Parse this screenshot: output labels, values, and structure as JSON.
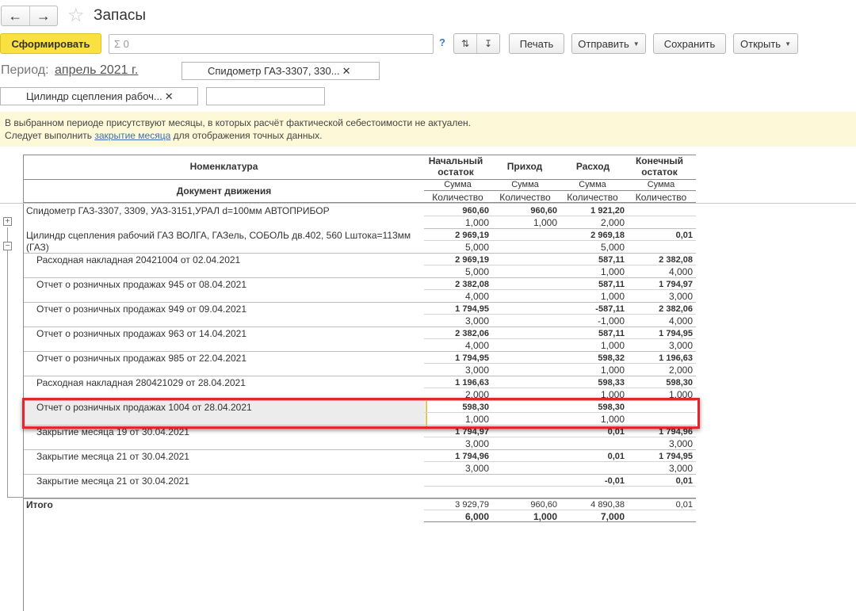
{
  "window": {
    "title": "Запасы"
  },
  "toolbar": {
    "generate_label": "Сформировать",
    "search_value": "Σ 0",
    "help_label": "?",
    "print_label": "Печать",
    "send_label": "Отправить",
    "save_label": "Сохранить",
    "open_label": "Открыть"
  },
  "filters": {
    "period_label": "Период:",
    "period_value": "апрель 2021 г.",
    "filter1": "Спидометр ГАЗ-3307, 330...",
    "filter2": "Цилиндр сцепления рабоч...",
    "filter3": ""
  },
  "warning": {
    "line1": "В выбранном периоде присутствуют месяцы, в которых расчёт фактической себестоимости не актуален.",
    "line2_before": "Следует выполнить ",
    "line2_link": "закрытие месяца",
    "line2_after": " для отображения точных данных."
  },
  "table": {
    "headers": {
      "nomenclature": "Номенклатура",
      "document": "Документ движения",
      "start": "Начальный остаток",
      "income": "Приход",
      "expense": "Расход",
      "end": "Конечный остаток",
      "sum": "Сумма",
      "qty": "Количество"
    },
    "rows": [
      {
        "name": "Спидометр ГАЗ-3307, 3309, УАЗ-3151,УРАЛ d=100мм АВТОПРИБОР",
        "level": 0,
        "sum": [
          "960,60",
          "960,60",
          "1 921,20",
          ""
        ],
        "qty": [
          "1,000",
          "1,000",
          "2,000",
          ""
        ]
      },
      {
        "name": "Цилиндр сцепления рабочий ГАЗ ВОЛГА, ГАЗель, СОБОЛЬ дв.402, 560 Lштока=113мм",
        "name2": "(ГАЗ)",
        "level": 0,
        "sum": [
          "2 969,19",
          "",
          "2 969,18",
          "0,01"
        ],
        "qty": [
          "5,000",
          "",
          "5,000",
          ""
        ]
      },
      {
        "name": "Расходная накладная 20421004 от 02.04.2021",
        "level": 1,
        "sum": [
          "2 969,19",
          "",
          "587,11",
          "2 382,08"
        ],
        "qty": [
          "5,000",
          "",
          "1,000",
          "4,000"
        ]
      },
      {
        "name": "Отчет о розничных продажах 945 от 08.04.2021",
        "level": 1,
        "sum": [
          "2 382,08",
          "",
          "587,11",
          "1 794,97"
        ],
        "qty": [
          "4,000",
          "",
          "1,000",
          "3,000"
        ]
      },
      {
        "name": "Отчет о розничных продажах 949 от 09.04.2021",
        "level": 1,
        "sum": [
          "1 794,95",
          "",
          "-587,11",
          "2 382,06"
        ],
        "qty": [
          "3,000",
          "",
          "-1,000",
          "4,000"
        ]
      },
      {
        "name": "Отчет о розничных продажах 963 от 14.04.2021",
        "level": 1,
        "sum": [
          "2 382,06",
          "",
          "587,11",
          "1 794,95"
        ],
        "qty": [
          "4,000",
          "",
          "1,000",
          "3,000"
        ]
      },
      {
        "name": "Отчет о розничных продажах 985 от 22.04.2021",
        "level": 1,
        "sum": [
          "1 794,95",
          "",
          "598,32",
          "1 196,63"
        ],
        "qty": [
          "3,000",
          "",
          "1,000",
          "2,000"
        ]
      },
      {
        "name": "Расходная накладная 280421029  от 28.04.2021",
        "level": 1,
        "sum": [
          "1 196,63",
          "",
          "598,33",
          "598,30"
        ],
        "qty": [
          "2,000",
          "",
          "1,000",
          "1,000"
        ]
      },
      {
        "name": "Отчет о розничных продажах 1004 от 28.04.2021",
        "level": 1,
        "sum": [
          "598,30",
          "",
          "598,30",
          ""
        ],
        "qty": [
          "1,000",
          "",
          "1,000",
          ""
        ]
      },
      {
        "name": "Закрытие месяца 19 от 30.04.2021",
        "level": 1,
        "sum": [
          "1 794,97",
          "",
          "0,01",
          "1 794,96"
        ],
        "qty": [
          "3,000",
          "",
          "",
          "3,000"
        ]
      },
      {
        "name": "Закрытие месяца 21 от 30.04.2021",
        "level": 1,
        "sum": [
          "1 794,96",
          "",
          "0,01",
          "1 794,95"
        ],
        "qty": [
          "3,000",
          "",
          "",
          "3,000"
        ]
      },
      {
        "name": "Закрытие месяца 21 от 30.04.2021",
        "level": 1,
        "sum": [
          "",
          "",
          "-0,01",
          "0,01"
        ],
        "qty": [
          "",
          "",
          "",
          ""
        ]
      }
    ],
    "total": {
      "label": "Итого",
      "sum": [
        "3 929,79",
        "960,60",
        "4 890,38",
        "0,01"
      ],
      "qty": [
        "6,000",
        "1,000",
        "7,000",
        ""
      ]
    }
  },
  "colors": {
    "primary_button": "#fbe042",
    "warning_bg": "#fdf9d8",
    "highlight_border": "#e1262d",
    "link": "#3c6fb0"
  },
  "icons": [
    "back-arrow-icon",
    "forward-arrow-icon",
    "star-icon",
    "sort-asc-icon",
    "sort-desc-icon",
    "chevron-down-icon",
    "close-icon",
    "expand-icon",
    "collapse-icon"
  ]
}
